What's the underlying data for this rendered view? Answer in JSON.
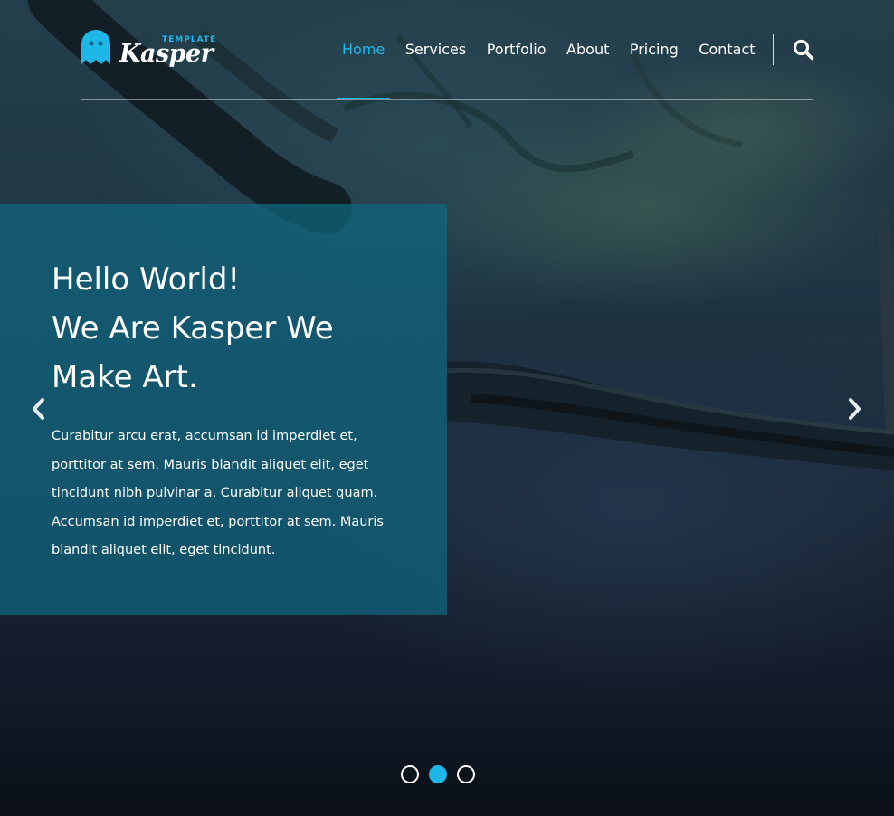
{
  "logo": {
    "template_label": "TEMPLATE",
    "name": "Kasper"
  },
  "nav": {
    "items": [
      {
        "label": "Home",
        "active": true
      },
      {
        "label": "Services",
        "active": false
      },
      {
        "label": "Portfolio",
        "active": false
      },
      {
        "label": "About",
        "active": false
      },
      {
        "label": "Pricing",
        "active": false
      },
      {
        "label": "Contact",
        "active": false
      }
    ],
    "search_icon": "search-icon"
  },
  "slide": {
    "title_lines": [
      "Hello World!",
      "We Are Kasper We",
      "Make Art."
    ],
    "paragraph": "Curabitur arcu erat, accumsan id imperdiet et, porttitor at sem. Mauris blandit aliquet elit, eget tincidunt nibh pulvinar a. Curabitur aliquet quam. Accumsan id imperdiet et, porttitor at sem. Mauris blandit aliquet elit, eget tincidunt."
  },
  "slider": {
    "prev_icon": "chevron-left-icon",
    "next_icon": "chevron-right-icon",
    "bullet_count": 3,
    "active_index": 1
  },
  "colors": {
    "accent": "#1fb7ea",
    "slide_box": "#0f6680",
    "text": "#ffffff"
  }
}
